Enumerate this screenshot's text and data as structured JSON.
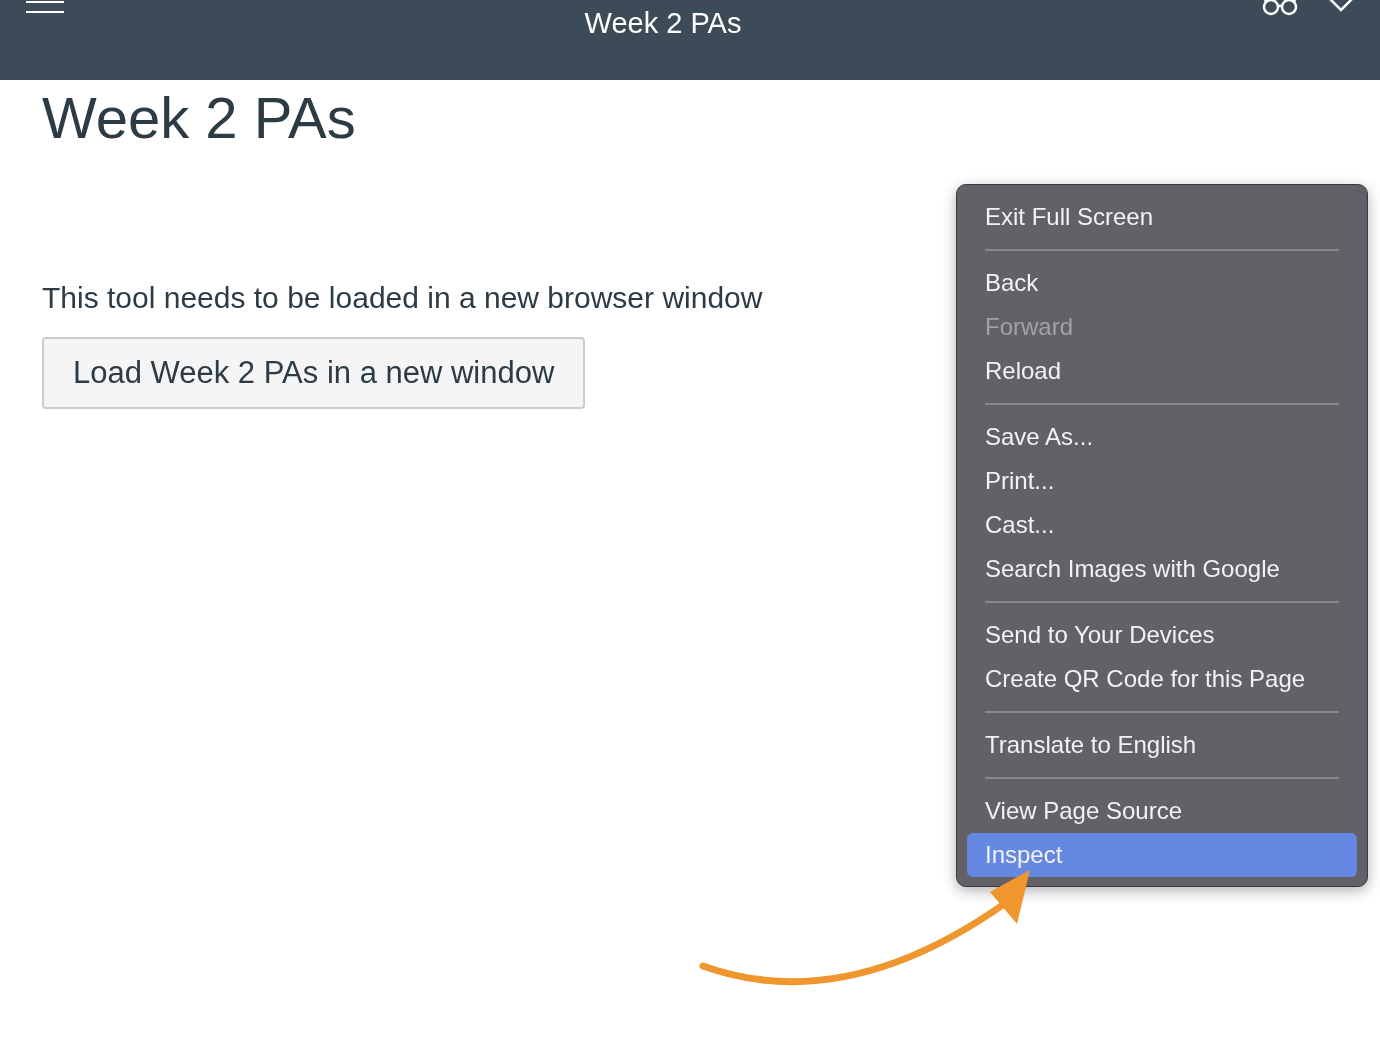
{
  "header": {
    "title": "Week 2 PAs"
  },
  "page": {
    "heading": "Week 2 PAs",
    "message": "This tool needs to be loaded in a new browser window",
    "button": "Load Week 2 PAs in a new window"
  },
  "context_menu": {
    "groups": [
      [
        {
          "label": "Exit Full Screen",
          "disabled": false,
          "selected": false
        }
      ],
      [
        {
          "label": "Back",
          "disabled": false,
          "selected": false
        },
        {
          "label": "Forward",
          "disabled": true,
          "selected": false
        },
        {
          "label": "Reload",
          "disabled": false,
          "selected": false
        }
      ],
      [
        {
          "label": "Save As...",
          "disabled": false,
          "selected": false
        },
        {
          "label": "Print...",
          "disabled": false,
          "selected": false
        },
        {
          "label": "Cast...",
          "disabled": false,
          "selected": false
        },
        {
          "label": "Search Images with Google",
          "disabled": false,
          "selected": false
        }
      ],
      [
        {
          "label": "Send to Your Devices",
          "disabled": false,
          "selected": false
        },
        {
          "label": "Create QR Code for this Page",
          "disabled": false,
          "selected": false
        }
      ],
      [
        {
          "label": "Translate to English",
          "disabled": false,
          "selected": false
        }
      ],
      [
        {
          "label": "View Page Source",
          "disabled": false,
          "selected": false
        },
        {
          "label": "Inspect",
          "disabled": false,
          "selected": true
        }
      ]
    ]
  }
}
